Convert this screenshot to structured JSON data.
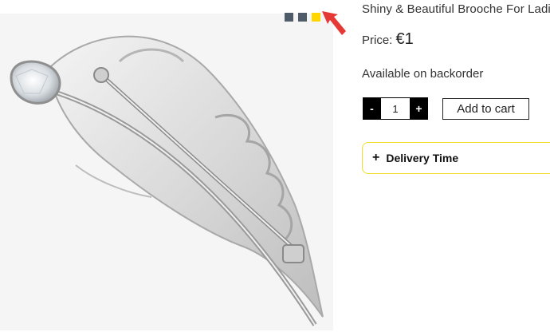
{
  "product": {
    "title": "Shiny & Beautiful Brooche For Ladies",
    "price_label": "Price:",
    "price_value": "€1",
    "availability": "Available on backorder",
    "image_subject": "feather-brooch"
  },
  "swatches": [
    {
      "color": "#4f5b69"
    },
    {
      "color": "#4f5b69"
    },
    {
      "color": "#ffd600"
    }
  ],
  "cart": {
    "minus_label": "-",
    "plus_label": "+",
    "quantity": "1",
    "add_label": "Add to cart"
  },
  "delivery": {
    "icon": "+",
    "label": "Delivery Time",
    "border_color": "#f2dd28"
  },
  "annotation": {
    "arrow_color": "#e53935"
  }
}
